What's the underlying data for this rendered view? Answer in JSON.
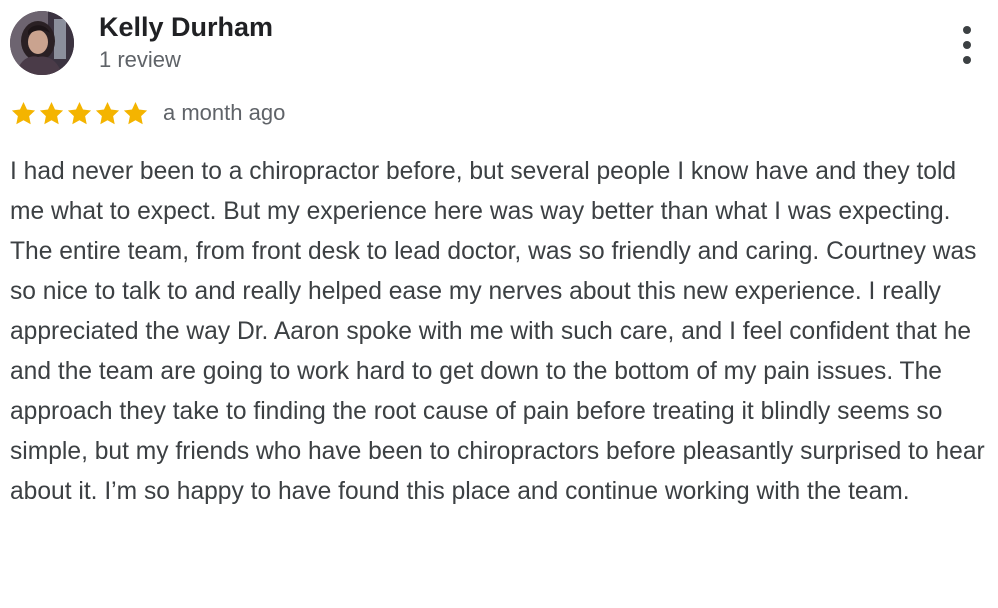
{
  "reviewer": {
    "name": "Kelly Durham",
    "review_count": "1 review"
  },
  "rating": {
    "stars": 5,
    "max_stars": 5,
    "star_color": "#F4B400",
    "date": "a month ago"
  },
  "review": {
    "text": "I had never been to a chiropractor before, but several people I know have and they told me what to expect. But my experience here was way better than what I was expecting. The entire team, from front desk to lead doctor, was so friendly and caring. Courtney was so nice to talk to and really helped ease my nerves about this new experience. I really appreciated the way Dr. Aaron spoke with me with such care, and I feel confident that he and the team are going to work hard to get down to the bottom of my pain issues. The approach they take to finding the root cause of pain before treating it blindly seems so simple, but my friends who have been to chiropractors before pleasantly surprised to hear about it. I’m so happy to have found this place and continue working with the team."
  },
  "icons": {
    "menu": "more-vert-icon",
    "star": "star-icon",
    "avatar": "avatar"
  }
}
